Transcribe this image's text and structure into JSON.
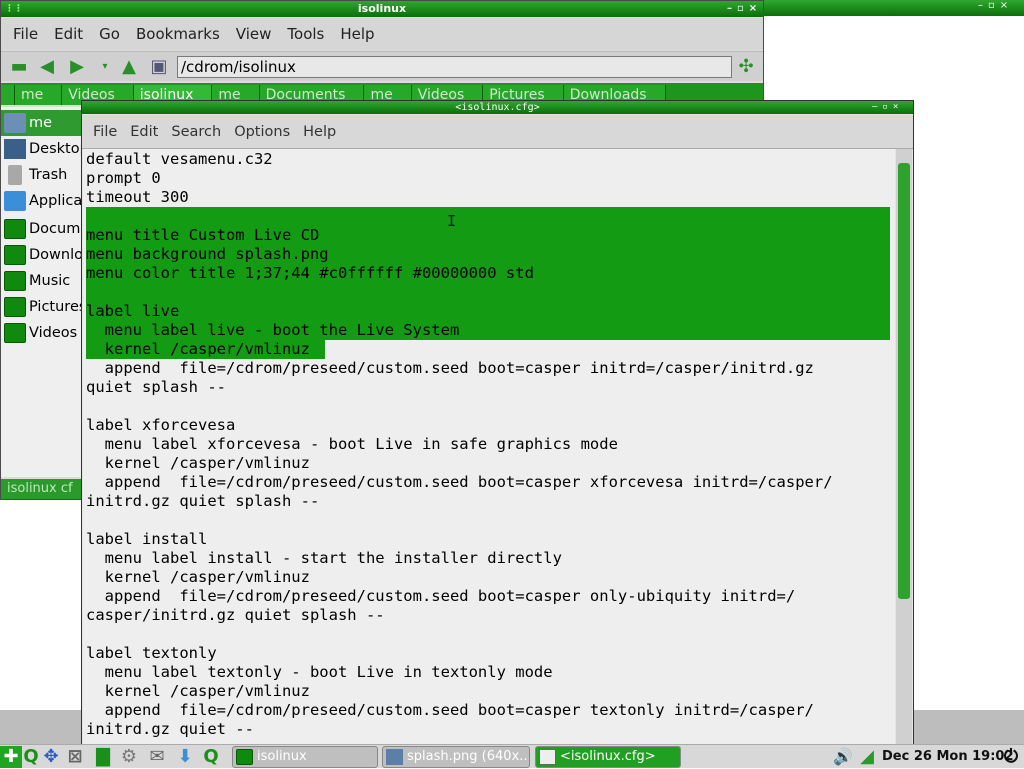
{
  "fm": {
    "title": "isolinux",
    "menu": [
      "File",
      "Edit",
      "Go",
      "Bookmarks",
      "View",
      "Tools",
      "Help"
    ],
    "location": "/cdrom/isolinux",
    "tabs": [
      "me",
      "Videos",
      "isolinux",
      "me",
      "Documents",
      "me",
      "Videos",
      "Pictures",
      "Downloads"
    ],
    "sidebar": [
      "me",
      "Desktop",
      "Trash",
      "Applications",
      "Documents",
      "Downloads",
      "Music",
      "Pictures",
      "Videos"
    ],
    "status": "isolinux cf"
  },
  "editor": {
    "title": "<isolinux.cfg>",
    "menu": [
      "File",
      "Edit",
      "Search",
      "Options",
      "Help"
    ],
    "lines": [
      "default vesamenu.c32",
      "prompt 0",
      "timeout 300",
      "",
      "menu title Custom Live CD",
      "menu background splash.png",
      "menu color title 1;37;44 #c0ffffff #00000000 std",
      "",
      "label live",
      "  menu label live - boot the Live System",
      "  kernel /casper/vmlinuz",
      "  append  file=/cdrom/preseed/custom.seed boot=casper initrd=/casper/initrd.gz",
      "quiet splash --",
      "",
      "label xforcevesa",
      "  menu label xforcevesa - boot Live in safe graphics mode",
      "  kernel /casper/vmlinuz",
      "  append  file=/cdrom/preseed/custom.seed boot=casper xforcevesa initrd=/casper/",
      "initrd.gz quiet splash --",
      "",
      "label install",
      "  menu label install - start the installer directly",
      "  kernel /casper/vmlinuz",
      "  append  file=/cdrom/preseed/custom.seed boot=casper only-ubiquity initrd=/",
      "casper/initrd.gz quiet splash --",
      "",
      "label textonly",
      "  menu label textonly - boot Live in textonly mode",
      "  kernel /casper/vmlinuz",
      "  append  file=/cdrom/preseed/custom.seed boot=casper textonly initrd=/casper/",
      "initrd.gz quiet --"
    ],
    "selection": {
      "from_line": 4,
      "to_line": 10,
      "last_line_chars": 24
    }
  },
  "taskbar": {
    "tasks": [
      "isolinux",
      "splash.png (640x...",
      "<isolinux.cfg>"
    ],
    "clock": "Dec 26 Mon 19:02"
  },
  "colors": {
    "accent": "#1a9a1a",
    "selection": "#139b13"
  }
}
